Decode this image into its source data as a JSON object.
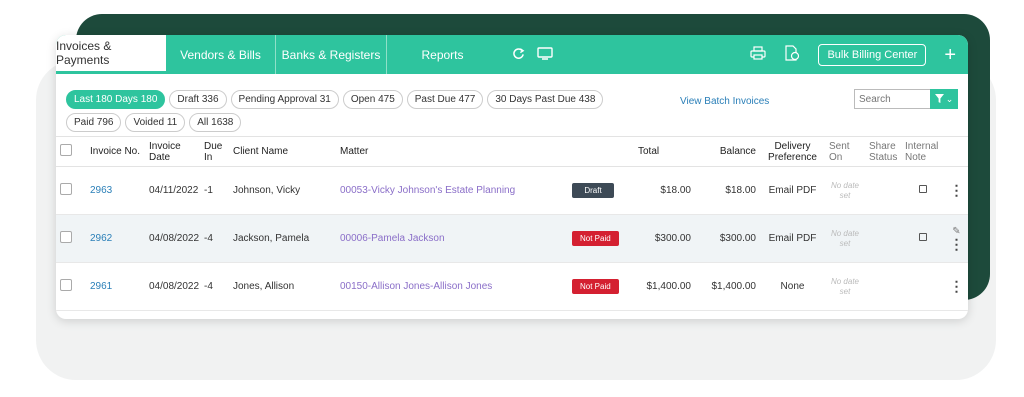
{
  "tabs": [
    {
      "label": "Invoices & Payments",
      "active": true
    },
    {
      "label": "Vendors & Bills",
      "active": false
    },
    {
      "label": "Banks & Registers",
      "active": false
    },
    {
      "label": "Reports",
      "active": false
    }
  ],
  "toolbar": {
    "bulk_billing_label": "Bulk Billing Center",
    "icons": [
      "refresh-icon",
      "monitor-icon",
      "print-icon",
      "document-money-icon",
      "plus-icon"
    ]
  },
  "filters": {
    "chips": [
      {
        "label": "Last 180 Days 180",
        "active": true
      },
      {
        "label": "Draft 336",
        "active": false
      },
      {
        "label": "Pending Approval 31",
        "active": false
      },
      {
        "label": "Open 475",
        "active": false
      },
      {
        "label": "Past Due 477",
        "active": false
      },
      {
        "label": "30 Days Past Due 438",
        "active": false
      },
      {
        "label": "Paid 796",
        "active": false
      },
      {
        "label": "Voided 11",
        "active": false
      },
      {
        "label": "All 1638",
        "active": false
      }
    ],
    "view_batch_label": "View Batch Invoices",
    "search_placeholder": "Search"
  },
  "table": {
    "headers": {
      "invoice_no": "Invoice No.",
      "invoice_date": "Invoice Date",
      "due_in": "Due In",
      "client_name": "Client Name",
      "matter": "Matter",
      "total": "Total",
      "balance": "Balance",
      "delivery": "Delivery Preference",
      "sent_on": "Sent On",
      "share_status": "Share Status",
      "internal_note": "Internal Note"
    },
    "rows": [
      {
        "invoice_no": "2963",
        "date": "04/11/2022",
        "due_in": "-1",
        "client": "Johnson, Vicky",
        "matter": "00053-Vicky Johnson's Estate Planning",
        "status": "Draft",
        "total": "$18.00",
        "balance": "$18.00",
        "delivery": "Email PDF",
        "sent_on": "No date set",
        "has_note": true,
        "has_attachment": false
      },
      {
        "invoice_no": "2962",
        "date": "04/08/2022",
        "due_in": "-4",
        "client": "Jackson, Pamela",
        "matter": "00006-Pamela Jackson",
        "status": "Not Paid",
        "total": "$300.00",
        "balance": "$300.00",
        "delivery": "Email PDF",
        "sent_on": "No date set",
        "has_note": true,
        "has_attachment": true
      },
      {
        "invoice_no": "2961",
        "date": "04/08/2022",
        "due_in": "-4",
        "client": "Jones, Allison",
        "matter": "00150-Allison Jones-Allison Jones",
        "status": "Not Paid",
        "total": "$1,400.00",
        "balance": "$1,400.00",
        "delivery": "None",
        "sent_on": "No date set",
        "has_note": false,
        "has_attachment": false
      }
    ]
  },
  "colors": {
    "brand": "#2ec49e",
    "draft": "#3d4a56",
    "not_paid": "#d42031",
    "link": "#2a7fb8",
    "matter_link": "#8a6ec8"
  }
}
